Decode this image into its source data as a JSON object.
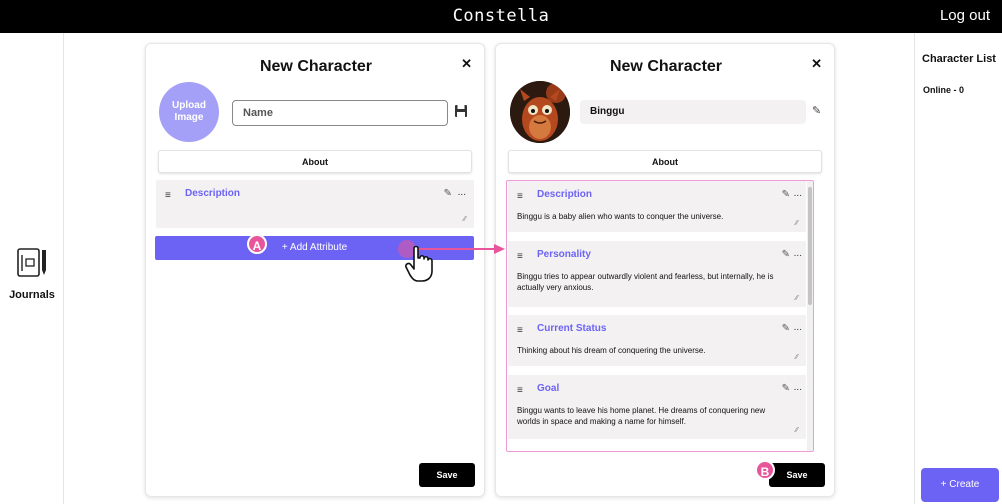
{
  "header": {
    "title": "Constella",
    "logout_label": "Log out"
  },
  "left_rail": {
    "journals_label": "Journals",
    "journals_icon": "journal-pen-icon"
  },
  "right_rail": {
    "title": "Character List",
    "online": "Online - 0",
    "create_label": "+ Create"
  },
  "colors": {
    "accent": "#6c63f5",
    "highlight": "#e8559a",
    "card_bg": "#f4f1f3"
  },
  "left_panel": {
    "title": "New Character",
    "close": "✕",
    "upload_label": "Upload Image",
    "name_placeholder": "Name",
    "about_label": "About",
    "attributes": [
      {
        "name": "Description",
        "handle": "≡",
        "edit": "✎",
        "more": "...",
        "text": ""
      }
    ],
    "add_attribute_label": "+ Add Attribute",
    "save_label": "Save"
  },
  "right_panel": {
    "title": "New Character",
    "close": "✕",
    "character_name": "Binggu",
    "about_label": "About",
    "attributes": [
      {
        "name": "Description",
        "handle": "≡",
        "edit": "✎",
        "more": "...",
        "text": "Binggu is a baby alien who wants to conquer the universe."
      },
      {
        "name": "Personality",
        "handle": "≡",
        "edit": "✎",
        "more": "...",
        "text": "Binggu tries to appear outwardly violent and fearless, but internally, he is actually very anxious."
      },
      {
        "name": "Current Status",
        "handle": "≡",
        "edit": "✎",
        "more": "...",
        "text": "Thinking about his dream of conquering the universe."
      },
      {
        "name": "Goal",
        "handle": "≡",
        "edit": "✎",
        "more": "...",
        "text": "Binggu wants to leave his home planet. He dreams of conquering new worlds in space and making a name for himself."
      }
    ],
    "save_label": "Save"
  },
  "annotations": {
    "badge_a": "A",
    "badge_b": "B"
  }
}
